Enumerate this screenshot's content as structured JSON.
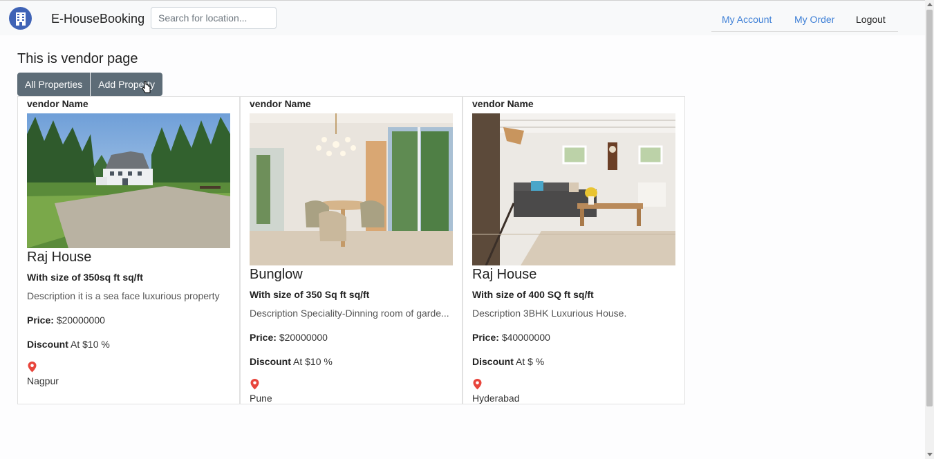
{
  "brand": {
    "name": "E-HouseBooking"
  },
  "search": {
    "placeholder": "Search for location..."
  },
  "nav": {
    "my_account": "My Account",
    "my_order": "My Order",
    "logout": "Logout"
  },
  "page": {
    "title": "This is vendor page"
  },
  "buttons": {
    "all_properties": "All Properties",
    "add_property": "Add Property"
  },
  "labels": {
    "price": "Price:",
    "discount": "Discount"
  },
  "cards": [
    {
      "vendor": "vendor Name",
      "title": "Raj House",
      "size": "With size of 350sq ft sq/ft",
      "description": "Description it is a sea face luxurious property",
      "price": "$20000000",
      "discount": "At $10 %",
      "city": "Nagpur"
    },
    {
      "vendor": "vendor Name",
      "title": "Bunglow",
      "size": "With size of 350 Sq ft sq/ft",
      "description": "Description Speciality-Dinning room of garde...",
      "price": "$20000000",
      "discount": "At $10 %",
      "city": "Pune"
    },
    {
      "vendor": "vendor Name",
      "title": "Raj House",
      "size": "With size of 400 SQ ft sq/ft",
      "description": "Description 3BHK Luxurious House.",
      "price": "$40000000",
      "discount": "At $ %",
      "city": "Hyderabad"
    }
  ],
  "colors": {
    "link": "#3d7fd6",
    "button": "#5d6c77",
    "logo": "#3f63b6",
    "pin": "#e8453c"
  }
}
